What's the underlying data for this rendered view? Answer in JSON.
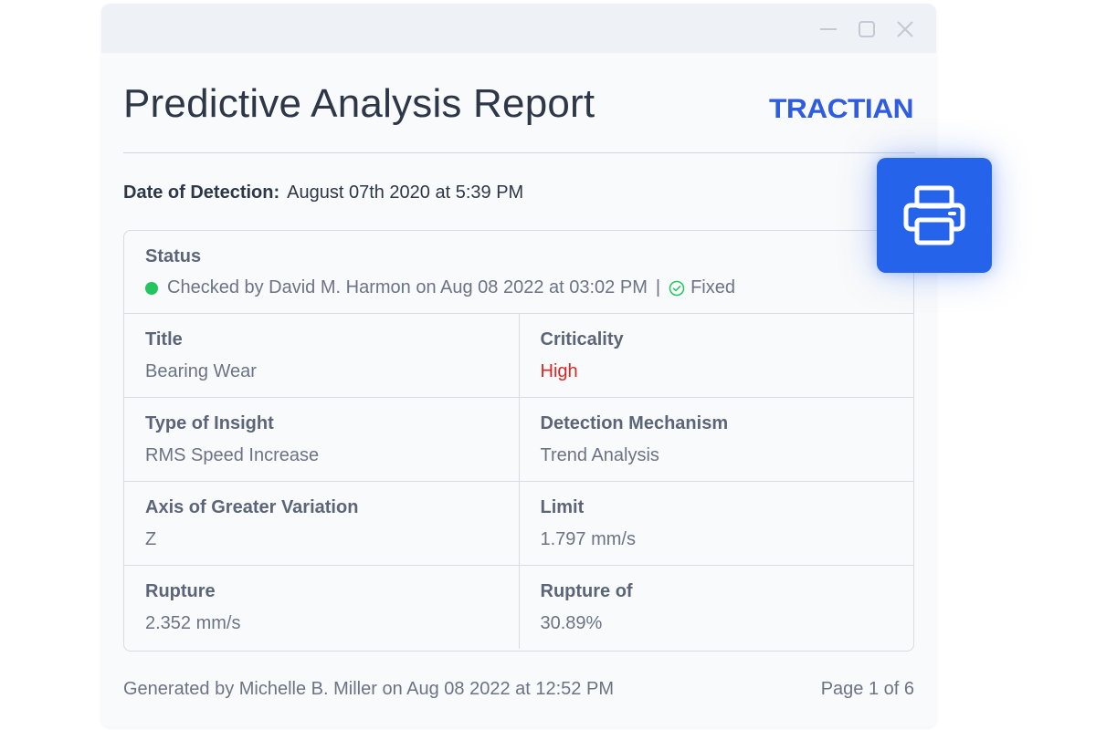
{
  "window": {
    "controls": [
      "minimize-icon",
      "maximize-icon",
      "close-icon"
    ]
  },
  "report": {
    "title": "Predictive Analysis Report",
    "logo_text": "TRACTIAN",
    "detection": {
      "label": "Date of Detection:",
      "value": "August 07th 2020 at 5:39 PM"
    },
    "status": {
      "label": "Status",
      "checked_text": "Checked by David M. Harmon on Aug 08 2022 at 03:02 PM",
      "separator": "|",
      "state": "Fixed"
    },
    "fields": [
      {
        "label": "Title",
        "value": "Bearing Wear"
      },
      {
        "label": "Criticality",
        "value": "High"
      },
      {
        "label": "Type of Insight",
        "value": "RMS Speed Increase"
      },
      {
        "label": "Detection Mechanism",
        "value": "Trend Analysis"
      },
      {
        "label": "Axis of Greater Variation",
        "value": "Z"
      },
      {
        "label": "Limit",
        "value": "1.797 mm/s"
      },
      {
        "label": "Rupture",
        "value": "2.352 mm/s"
      },
      {
        "label": "Rupture of",
        "value": "30.89%"
      }
    ],
    "footer": {
      "generated": "Generated by Michelle B. Miller on Aug 08 2022 at 12:52 PM",
      "page": "Page 1 of 6"
    }
  },
  "print_button": {
    "icon": "printer-icon"
  },
  "colors": {
    "brand_blue": "#2563eb",
    "logo_blue": "#2f5ce0",
    "critical_red": "#dc2626",
    "status_green": "#22c55e"
  }
}
